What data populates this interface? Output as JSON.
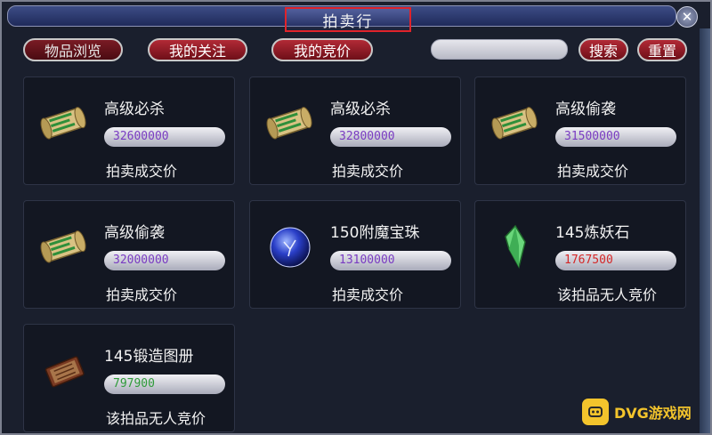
{
  "window": {
    "title": "拍卖行"
  },
  "toolbar": {
    "tabs": [
      {
        "label": "物品浏览"
      },
      {
        "label": "我的关注"
      },
      {
        "label": "我的竞价"
      }
    ],
    "search_value": "",
    "search_label": "搜索",
    "reset_label": "重置"
  },
  "items": [
    {
      "name": "高级必杀",
      "price": "32600000",
      "price_color": "#7a3cc2",
      "status": "拍卖成交价",
      "icon": "scroll-icon"
    },
    {
      "name": "高级必杀",
      "price": "32800000",
      "price_color": "#7a3cc2",
      "status": "拍卖成交价",
      "icon": "scroll-icon"
    },
    {
      "name": "高级偷袭",
      "price": "31500000",
      "price_color": "#7a3cc2",
      "status": "拍卖成交价",
      "icon": "scroll-icon"
    },
    {
      "name": "高级偷袭",
      "price": "32000000",
      "price_color": "#7a3cc2",
      "status": "拍卖成交价",
      "icon": "scroll-icon"
    },
    {
      "name": "150附魔宝珠",
      "price": "13100000",
      "price_color": "#7a3cc2",
      "status": "拍卖成交价",
      "icon": "orb-icon"
    },
    {
      "name": "145炼妖石",
      "price": "1767500",
      "price_color": "#d42828",
      "status": "该拍品无人竞价",
      "icon": "crystal-icon"
    },
    {
      "name": "145锻造图册",
      "price": "797900",
      "price_color": "#2f9b3a",
      "status": "该拍品无人竞价",
      "icon": "book-icon"
    }
  ],
  "watermark": {
    "text": "DVG游戏网"
  }
}
